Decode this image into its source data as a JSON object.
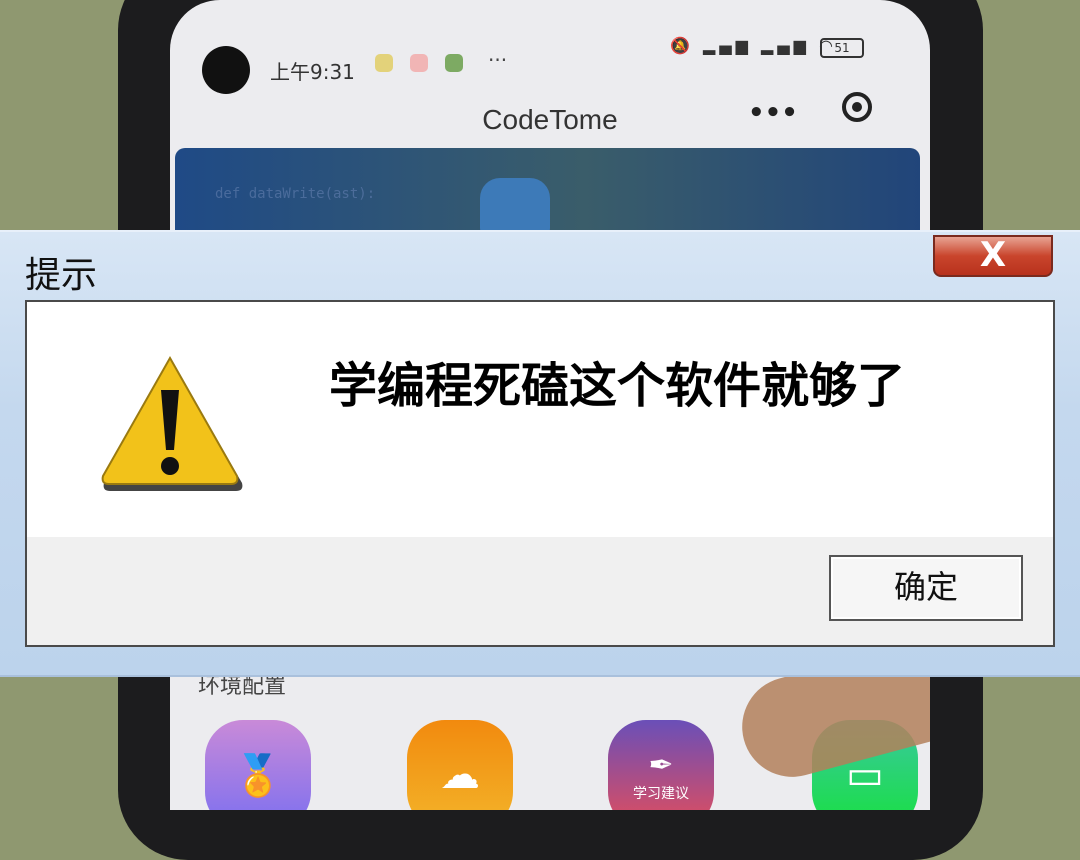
{
  "phone": {
    "status_bar": {
      "time": "上午9:31",
      "notification_icons": [
        "music-icon",
        "record-icon",
        "message-icon"
      ],
      "more": "···",
      "right_icons": [
        "mute-icon",
        "signal-hd-icon",
        "signal-hd-icon",
        "wifi-icon"
      ],
      "battery": "51"
    },
    "app_title": "CodeTome",
    "menu_dots": "•••",
    "banner_code": "def dataWrite(ast):",
    "section_label": "环境配置",
    "app_icons": [
      {
        "name": "medal-icon",
        "color": "#b78ae0"
      },
      {
        "name": "cloud-download-icon",
        "color": "#f39a14"
      },
      {
        "name": "quill-icon",
        "color": "#8c4fb0",
        "label": "学习建议"
      },
      {
        "name": "storage-box-icon",
        "color": "#22c94a"
      }
    ]
  },
  "dialog": {
    "title": "提示",
    "close_label": "X",
    "message": "学编程死磕这个软件就够了",
    "ok_label": "确定",
    "icon": "warning-icon"
  }
}
